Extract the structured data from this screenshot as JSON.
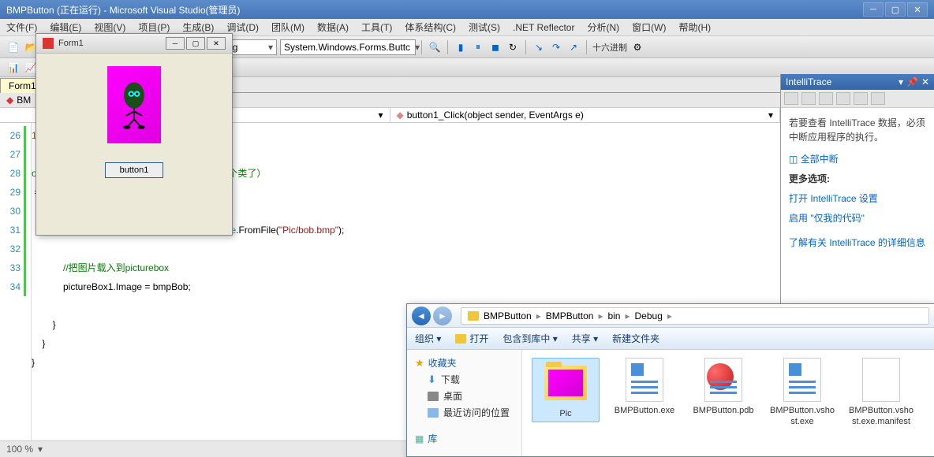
{
  "vs": {
    "title": "BMPButton (正在运行) - Microsoft Visual Studio(管理员)",
    "menu": [
      "文件(F)",
      "编辑(E)",
      "视图(V)",
      "项目(P)",
      "生成(B)",
      "调试(D)",
      "团队(M)",
      "数据(A)",
      "工具(T)",
      "体系结构(C)",
      "测试(S)",
      ".NET Reflector",
      "分析(N)",
      "窗口(W)",
      "帮助(H)"
    ],
    "config": "Debug",
    "platform": "System.Windows.Forms.Buttc",
    "hex": "十六进制",
    "tab": "Form1.",
    "file_tab": "BM",
    "nav_right": "button1_Click(object sender, EventArgs e)",
    "zoom": "100 %"
  },
  "code": {
    "lines": [
      {
        "n": "",
        "html": "<span class='mth'>1_Click</span>(<span class='kw'>object</span> sender, <span class='ty'>EventArgs</span> e)"
      },
      {
        "n": "",
        "html": ""
      },
      {
        "n": "",
        "html": "onPic的某个成员（因为ButtonPic已经是你的一个类了）",
        "comment": true
      },
      {
        "n": "",
        "html": " = <span class='ty'>ButtonPic</span>.bob;"
      },
      {
        "n": "",
        "html": ""
      },
      {
        "n": "26",
        "html": "            <span class='ty'>Image</span> bmpBob = System.Drawing.<span class='ty'>Image</span>.FromFile(<span class='st'>\"Pic/bob.bmp\"</span>);"
      },
      {
        "n": "27",
        "html": ""
      },
      {
        "n": "28",
        "html": "            <span class='cm'>//把图片载入到picturebox</span>"
      },
      {
        "n": "29",
        "html": "            pictureBox1.Image = bmpBob;"
      },
      {
        "n": "30",
        "html": ""
      },
      {
        "n": "31",
        "html": "        }"
      },
      {
        "n": "32",
        "html": "    }"
      },
      {
        "n": "33",
        "html": "}"
      },
      {
        "n": "34",
        "html": ""
      }
    ]
  },
  "intelli": {
    "title": "IntelliTrace",
    "msg": "若要查看 IntelliTrace 数据，必须中断应用程序的执行。",
    "break_all": "全部中断",
    "more": "更多选项:",
    "links": [
      "打开 IntelliTrace 设置",
      "启用 \"仅我的代码\"",
      "了解有关 IntelliTrace 的详细信息"
    ]
  },
  "form1": {
    "title": "Form1",
    "button": "button1"
  },
  "expl": {
    "breadcrumb": [
      "BMPButton",
      "BMPButton",
      "bin",
      "Debug"
    ],
    "toolbar": {
      "org": "组织 ▾",
      "open": "打开",
      "lib": "包含到库中 ▾",
      "share": "共享 ▾",
      "new": "新建文件夹"
    },
    "nav": {
      "fav": "收藏夹",
      "items": [
        "下载",
        "桌面",
        "最近访问的位置"
      ],
      "lib": "库"
    },
    "files": [
      {
        "name": "Pic",
        "type": "folder",
        "sel": true
      },
      {
        "name": "BMPButton.exe",
        "type": "exe"
      },
      {
        "name": "BMPButton.pdb",
        "type": "pdb"
      },
      {
        "name": "BMPButton.vshost.exe",
        "type": "exe"
      },
      {
        "name": "BMPButton.vshost.exe.manifest",
        "type": "manifest"
      }
    ]
  }
}
